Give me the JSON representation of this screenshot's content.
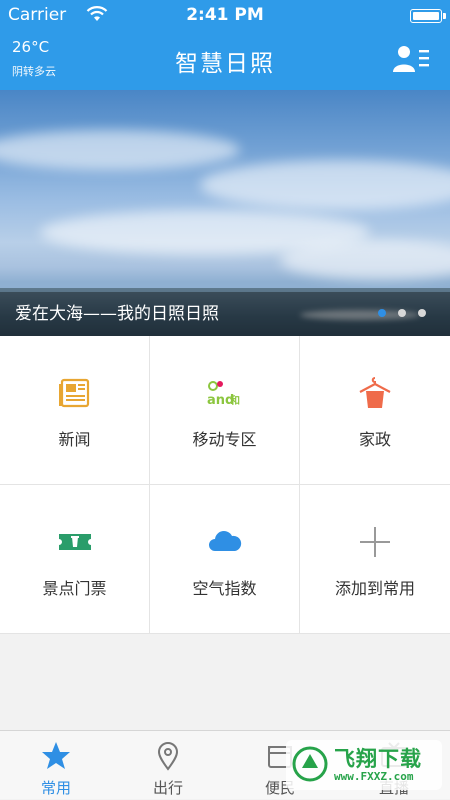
{
  "status_bar": {
    "carrier": "Carrier",
    "time": "2:41 PM",
    "battery_level": 1.0
  },
  "header": {
    "temperature": "26°C",
    "weather": "阴转多云",
    "title": "智慧日照",
    "user_icon": "user-menu-icon"
  },
  "banner": {
    "caption": "爱在大海——我的日照日照",
    "slide_count": 3,
    "active_slide": 1
  },
  "grid": {
    "items": [
      {
        "label": "新闻",
        "icon": "newspaper-icon",
        "color": "#e8a632"
      },
      {
        "label": "移动专区",
        "icon": "and-he-icon",
        "color": "#8cc63f"
      },
      {
        "label": "家政",
        "icon": "clothes-hanger-icon",
        "color": "#ef6b4a"
      },
      {
        "label": "景点门票",
        "icon": "ticket-icon",
        "color": "#2a9d6a"
      },
      {
        "label": "空气指数",
        "icon": "cloud-icon",
        "color": "#2f8fe4"
      },
      {
        "label": "添加到常用",
        "icon": "plus-icon",
        "color": "#999999"
      }
    ]
  },
  "tabbar": {
    "tabs": [
      {
        "label": "常用",
        "icon": "star-icon",
        "active": true
      },
      {
        "label": "出行",
        "icon": "location-pin-icon",
        "active": false
      },
      {
        "label": "便民",
        "icon": "convenience-icon",
        "active": false
      },
      {
        "label": "直播",
        "icon": "tv-icon",
        "active": false
      }
    ]
  },
  "watermark": {
    "text": "飞翔下载",
    "url": "www.FXXZ.com"
  },
  "colors": {
    "brand": "#2f9be9",
    "accent": "#2f8fe4"
  }
}
